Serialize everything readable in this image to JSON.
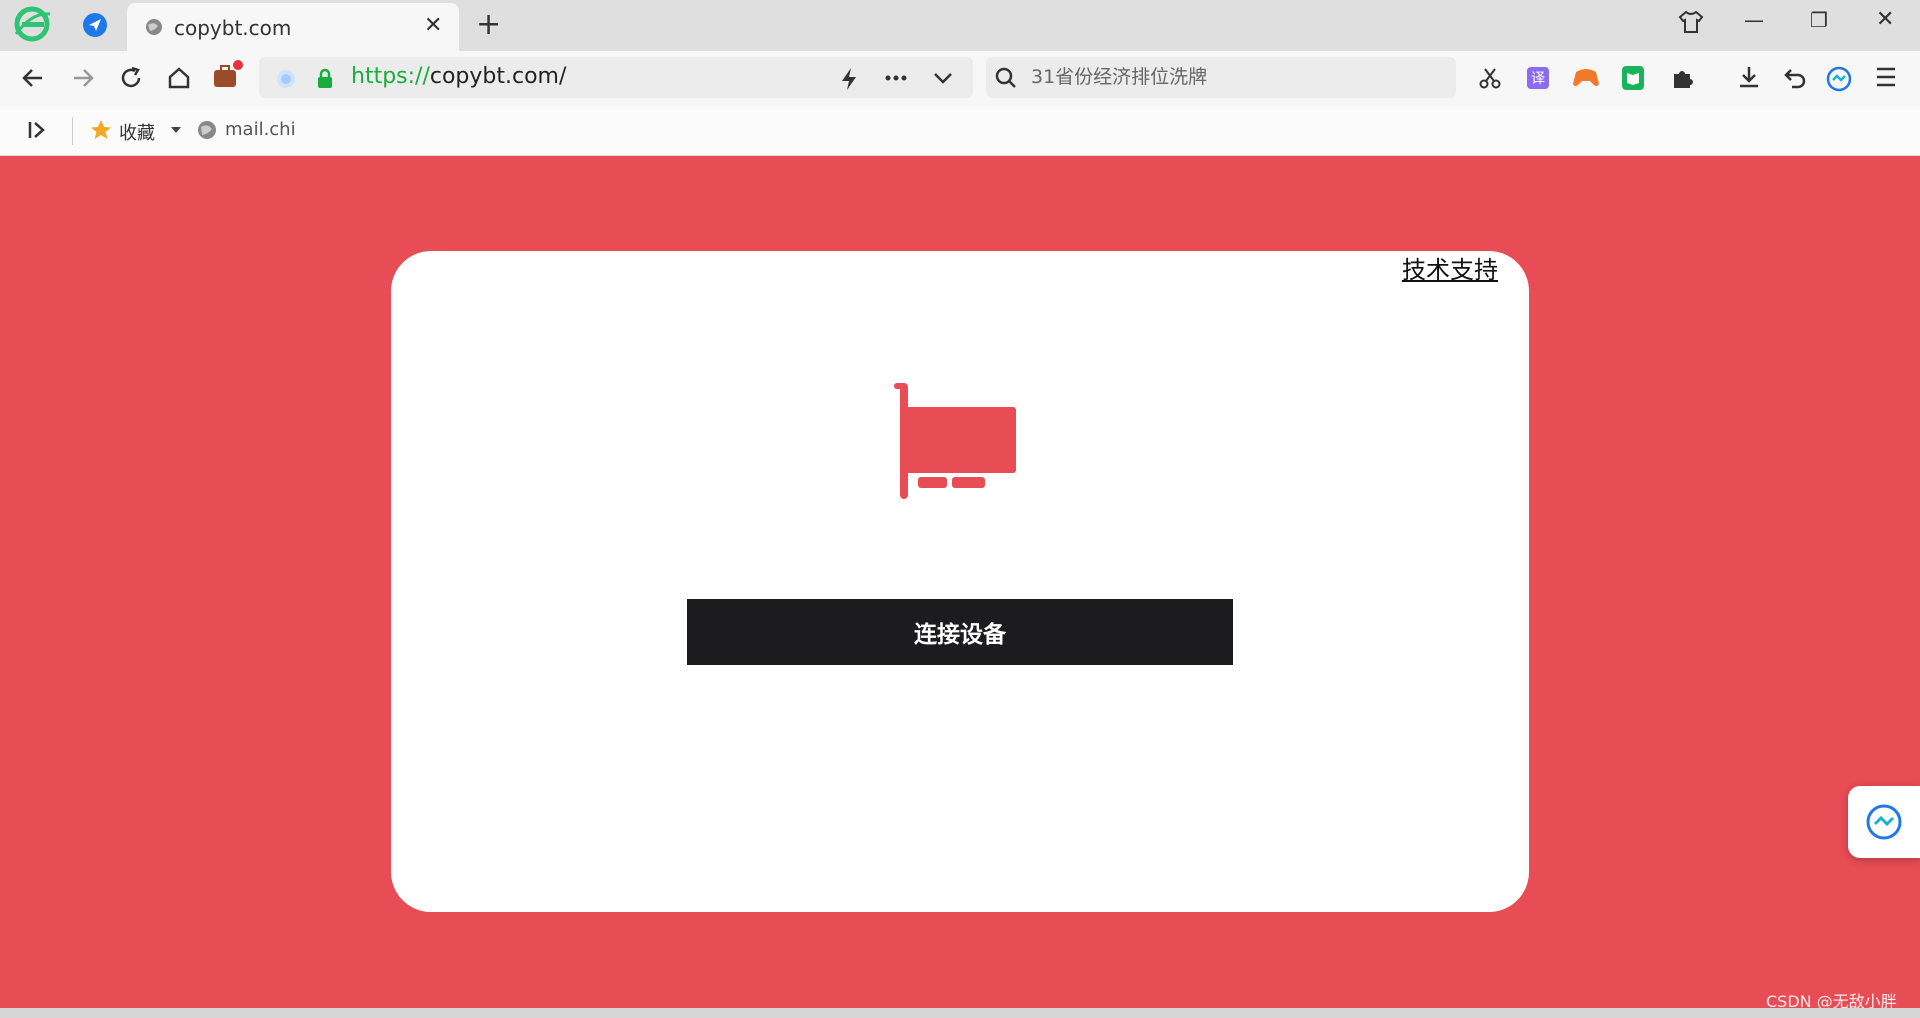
{
  "browser": {
    "tab": {
      "title": "copybt.com",
      "close": "✕",
      "new": "+"
    },
    "address": {
      "protocol": "https://",
      "host": "copybt.com/"
    },
    "search": {
      "placeholder": "31省份经济排位洗牌"
    },
    "bookmarks": {
      "favorites_label": "收藏",
      "item1": "mail.chi"
    },
    "window": {
      "minimize": "—",
      "restore": "❐",
      "close": "✕"
    }
  },
  "page": {
    "support_link": "技术支持",
    "connect_button": "连接设备",
    "accent_color": "#e84c55"
  },
  "watermark": "CSDN @无敌小胖"
}
